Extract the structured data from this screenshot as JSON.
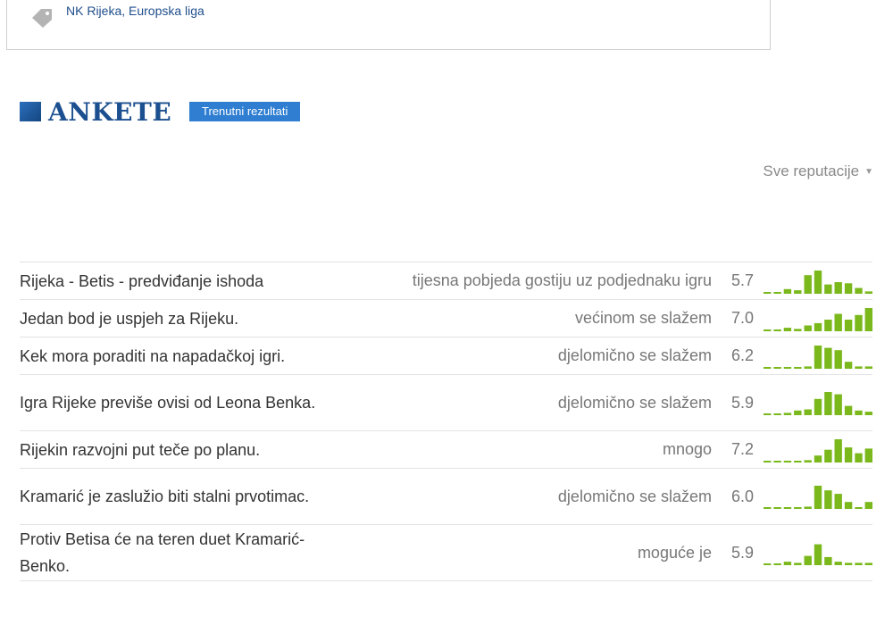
{
  "tag_box": {
    "tags": "NK Rijeka, Europska liga",
    "icon": "tag-icon"
  },
  "section": {
    "title": "ANKETE",
    "badge": "Trenutni rezultati"
  },
  "filter": {
    "label": "Sve reputacije",
    "icon": "caret-down-icon"
  },
  "colors": {
    "accent": "#2f7ed1",
    "title": "#1b4f8f",
    "bar": "#7ab81c"
  },
  "polls": [
    {
      "question": "Rijeka - Betis - predviđanje ishoda",
      "answer": "tijesna pobjeda gostiju uz podjednaku igru",
      "score": "5.7",
      "distribution": [
        0.05,
        0.05,
        0.2,
        0.15,
        0.8,
        1.0,
        0.4,
        0.5,
        0.45,
        0.25,
        0.1
      ],
      "lines": 1
    },
    {
      "question": "Jedan bod je uspjeh za Rijeku.",
      "answer": "većinom se slažem",
      "score": "7.0",
      "distribution": [
        0.05,
        0.05,
        0.15,
        0.1,
        0.25,
        0.35,
        0.5,
        0.75,
        0.5,
        0.7,
        1.0
      ],
      "lines": 1
    },
    {
      "question": "Kek mora poraditi na napadačkoj igri.",
      "answer": "djelomično se slažem",
      "score": "6.2",
      "distribution": [
        0.05,
        0.05,
        0.05,
        0.05,
        0.1,
        1.0,
        0.9,
        0.8,
        0.3,
        0.1,
        0.1
      ],
      "lines": 1
    },
    {
      "question": "Igra Rijeke previše ovisi od Leona Benka.",
      "answer": "djelomično se slažem",
      "score": "5.9",
      "distribution": [
        0.05,
        0.05,
        0.1,
        0.2,
        0.25,
        0.7,
        1.0,
        0.9,
        0.4,
        0.2,
        0.15
      ],
      "lines": 2
    },
    {
      "question": "Rijekin razvojni put teče po planu.",
      "answer": "mnogo",
      "score": "7.2",
      "distribution": [
        0.05,
        0.05,
        0.05,
        0.05,
        0.1,
        0.3,
        0.55,
        1.0,
        0.65,
        0.4,
        0.6
      ],
      "lines": 1
    },
    {
      "question": "Kramarić je zaslužio biti stalni prvotimac.",
      "answer": "djelomično se slažem",
      "score": "6.0",
      "distribution": [
        0.05,
        0.05,
        0.05,
        0.05,
        0.1,
        1.0,
        0.8,
        0.65,
        0.3,
        0.05,
        0.3
      ],
      "lines": 2
    },
    {
      "question": "Protiv Betisa će na teren duet Kramarić-Benko.",
      "answer": "moguće je",
      "score": "5.9",
      "distribution": [
        0.05,
        0.05,
        0.15,
        0.1,
        0.4,
        0.9,
        0.35,
        0.15,
        0.1,
        0.1,
        0.1
      ],
      "lines": 2
    }
  ]
}
